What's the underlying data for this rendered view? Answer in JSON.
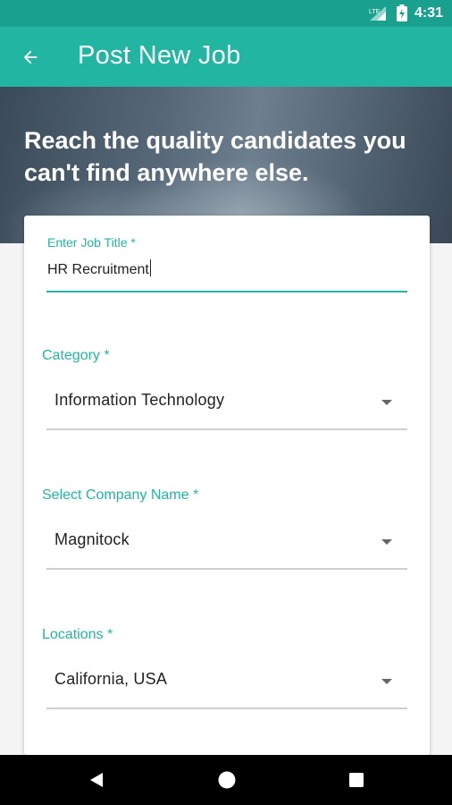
{
  "status_bar": {
    "time": "4:31",
    "network": "LTE"
  },
  "app_bar": {
    "title": "Post New Job",
    "back_icon": "arrow-left-icon"
  },
  "hero": {
    "tagline": "Reach the quality candidates you can't find anywhere else."
  },
  "form": {
    "job_title": {
      "label": "Enter Job Title *",
      "value": "HR Recruitment"
    },
    "category": {
      "label": "Category *",
      "value": "Information Technology"
    },
    "company": {
      "label": "Select Company Name *",
      "value": "Magnitock"
    },
    "location": {
      "label": "Locations *",
      "value": "California, USA"
    }
  },
  "colors": {
    "primary": "#21b5a2",
    "primary_dark": "#19a08f"
  }
}
